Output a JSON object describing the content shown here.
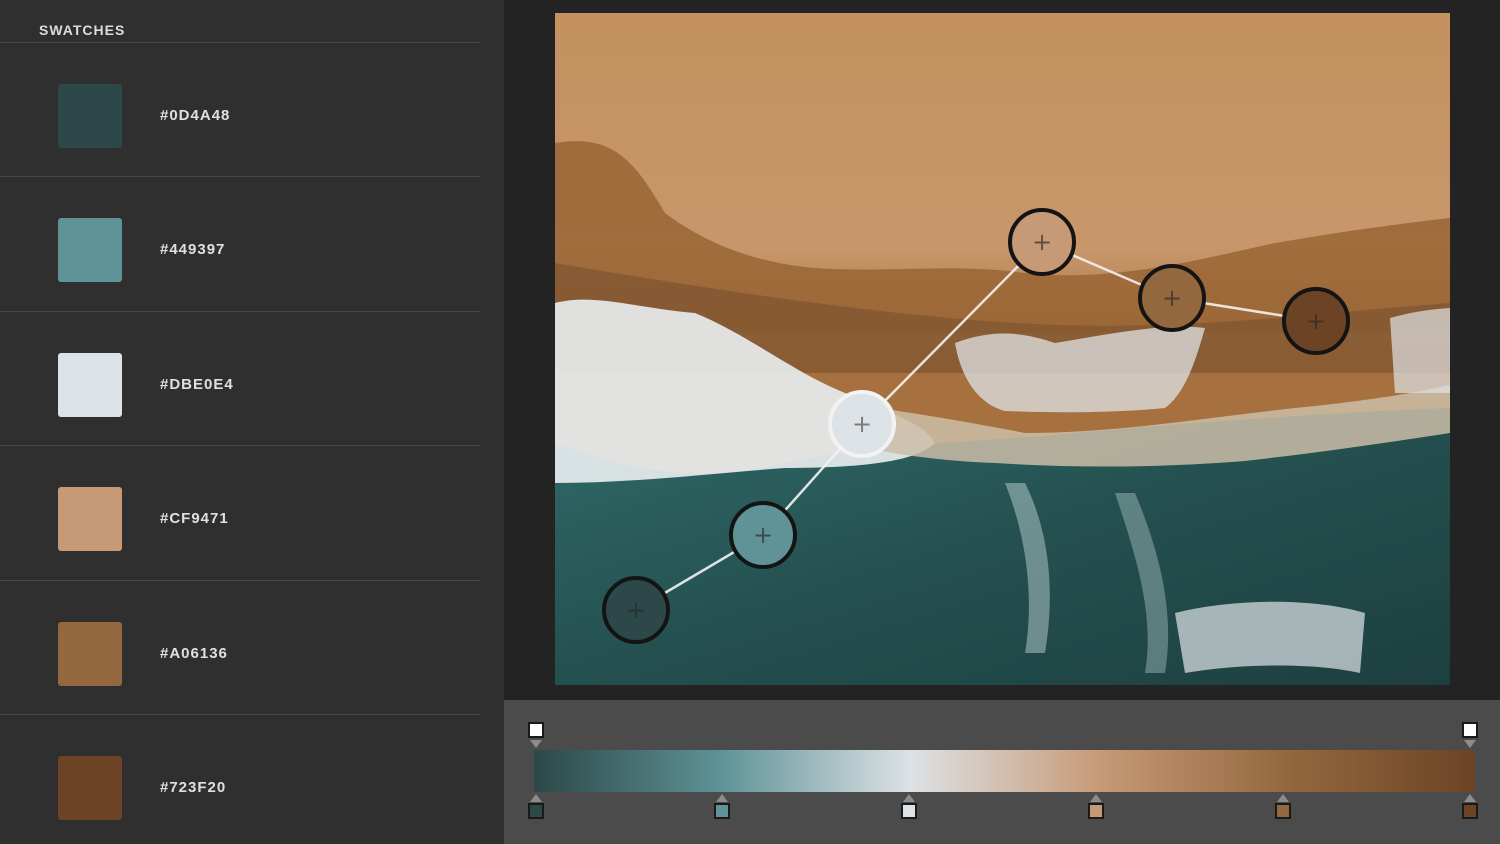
{
  "swatches": {
    "title": "SWATCHES",
    "items": [
      {
        "hex": "#0D4A48",
        "color": "#2c4848"
      },
      {
        "hex": "#449397",
        "color": "#5f9397"
      },
      {
        "hex": "#DBE0E4",
        "color": "#dde2e6"
      },
      {
        "hex": "#CF9471",
        "color": "#c79a77"
      },
      {
        "hex": "#A06136",
        "color": "#94683e"
      },
      {
        "hex": "#723F20",
        "color": "#6c4425"
      }
    ]
  },
  "gradient": {
    "stops": [
      {
        "color": "#2c4848"
      },
      {
        "color": "#5f9397"
      },
      {
        "color": "#dde2e6"
      },
      {
        "color": "#c79a77"
      },
      {
        "color": "#94683e"
      },
      {
        "color": "#6c4425"
      }
    ]
  }
}
